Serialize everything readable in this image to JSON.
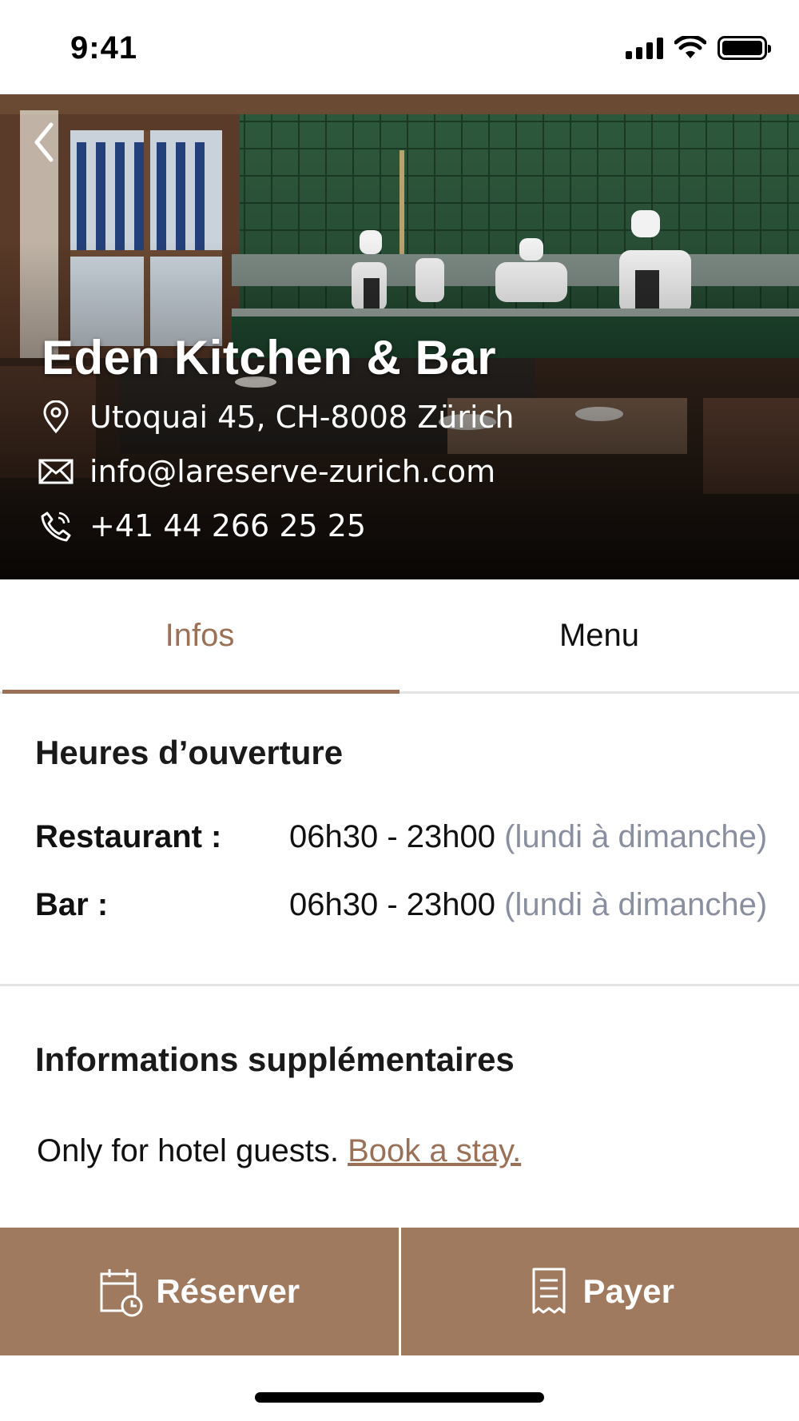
{
  "status_bar": {
    "time": "9:41"
  },
  "restaurant": {
    "name": "Eden Kitchen & Bar",
    "address": "Utoquai 45, CH-8008 Zürich",
    "email": "info@lareserve-zurich.com",
    "phone": "+41 44 266 25 25"
  },
  "tabs": [
    {
      "label": "Infos",
      "active": true
    },
    {
      "label": "Menu",
      "active": false
    }
  ],
  "hours": {
    "title": "Heures d’ouverture",
    "rows": [
      {
        "label": "Restaurant :",
        "time": "06h30 - 23h00",
        "days": "(lundi à dimanche)"
      },
      {
        "label": "Bar :",
        "time": "06h30 - 23h00",
        "days": "(lundi à dimanche)"
      }
    ]
  },
  "extra": {
    "title": "Informations supplémentaires",
    "text": "Only for hotel guests.",
    "link": "Book a stay."
  },
  "actions": {
    "reserve": "Réserver",
    "pay": "Payer"
  },
  "colors": {
    "accent": "#9a7156",
    "action_bar": "#a07a5f",
    "muted": "#8a8fa0"
  },
  "icons": [
    "back-arrow-icon",
    "location-pin-icon",
    "envelope-icon",
    "phone-icon",
    "calendar-clock-icon",
    "receipt-icon",
    "cellular-signal-icon",
    "wifi-icon",
    "battery-icon"
  ]
}
